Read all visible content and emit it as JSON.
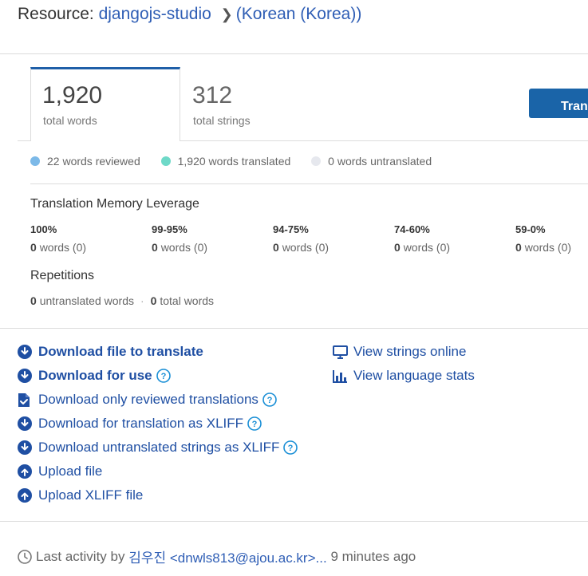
{
  "header": {
    "prefix": "Resource:",
    "resource": "djangojs-studio",
    "language": "(Korean (Korea))"
  },
  "stats": {
    "words_value": "1,920",
    "words_label": "total words",
    "strings_value": "312",
    "strings_label": "total strings",
    "translate_button": "Translate"
  },
  "legend": [
    {
      "label": "22 words reviewed",
      "color": "#7cb9e8"
    },
    {
      "label": "1,920 words translated",
      "color": "#6ed9c8"
    },
    {
      "label": "0 words untranslated",
      "color": "#e6e8ee"
    }
  ],
  "tm": {
    "title": "Translation Memory Leverage",
    "columns": [
      {
        "range": "100%",
        "count": "0",
        "rest": "words (0)"
      },
      {
        "range": "99-95%",
        "count": "0",
        "rest": "words (0)"
      },
      {
        "range": "94-75%",
        "count": "0",
        "rest": "words (0)"
      },
      {
        "range": "74-60%",
        "count": "0",
        "rest": "words (0)"
      },
      {
        "range": "59-0%",
        "count": "0",
        "rest": "words (0)"
      }
    ]
  },
  "repetitions": {
    "title": "Repetitions",
    "untranslated_count": "0",
    "untranslated_label": "untranslated words",
    "total_count": "0",
    "total_label": "total words"
  },
  "actions_left": [
    {
      "label": "Download file to translate",
      "icon": "download-circle-icon",
      "help": false,
      "bold": true
    },
    {
      "label": "Download for use",
      "icon": "download-circle-icon",
      "help": true,
      "bold": true
    },
    {
      "label": "Download only reviewed translations",
      "icon": "file-check-icon",
      "help": true,
      "bold": false
    },
    {
      "label": "Download for translation as XLIFF",
      "icon": "download-circle-icon",
      "help": true,
      "bold": false
    },
    {
      "label": "Download untranslated strings as XLIFF",
      "icon": "download-circle-icon",
      "help": true,
      "bold": false
    },
    {
      "label": "Upload file",
      "icon": "upload-circle-icon",
      "help": false,
      "bold": false
    },
    {
      "label": "Upload XLIFF file",
      "icon": "upload-circle-icon",
      "help": false,
      "bold": false
    }
  ],
  "actions_right": [
    {
      "label": "View strings online",
      "icon": "monitor-icon"
    },
    {
      "label": "View language stats",
      "icon": "bar-chart-icon"
    }
  ],
  "footer": {
    "prefix": "Last activity by",
    "user": "김우진 <dnwls813@ajou.ac.kr>...",
    "time": "9 minutes ago"
  },
  "colors": {
    "accent": "#1a64a8",
    "link": "#1f4fa3",
    "reviewed": "#7cb9e8",
    "translated": "#6ed9c8",
    "untranslated": "#e6e8ee"
  }
}
